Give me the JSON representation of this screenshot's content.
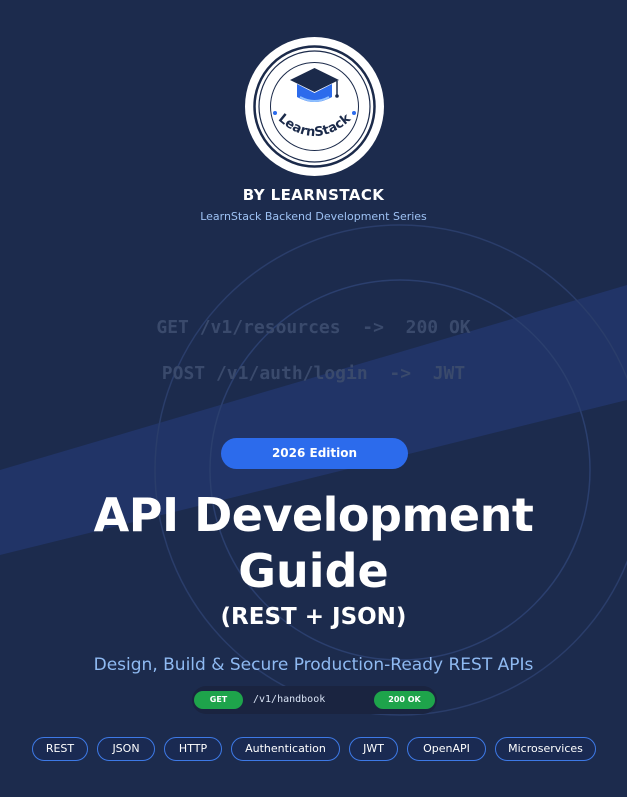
{
  "brand": {
    "logo_text": "LearnStack",
    "byline": "BY LEARNSTACK",
    "series": "LearnStack Backend Development Series"
  },
  "code_lines": [
    "GET /v1/resources  ->  200 OK",
    "POST /v1/auth/login  ->  JWT"
  ],
  "edition": "2026 Edition",
  "title": {
    "line1": "API Development",
    "line2": "Guide",
    "subtitle": "(REST + JSON)"
  },
  "tagline": "Design, Build & Secure Production-Ready REST APIs",
  "endpoint": {
    "method": "GET",
    "path": "/v1/handbook",
    "status": "200 OK"
  },
  "tags": [
    "REST",
    "JSON",
    "HTTP",
    "Authentication",
    "JWT",
    "OpenAPI",
    "Microservices"
  ],
  "colors": {
    "background": "#1c2b4d",
    "accent": "#2c6bec",
    "success": "#1ea44b",
    "tagline": "#8fbaf2"
  }
}
